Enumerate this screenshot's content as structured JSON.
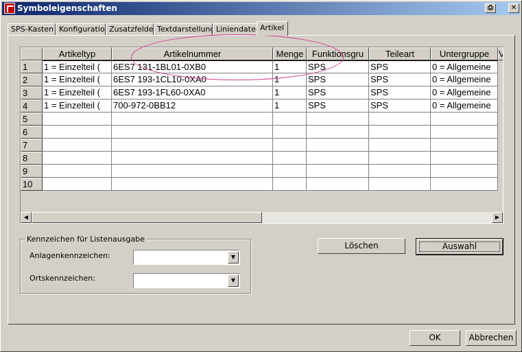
{
  "window": {
    "title": "Symboleigenschaften"
  },
  "tabs": [
    {
      "label": "SPS-Kasten"
    },
    {
      "label": "Konfiguration"
    },
    {
      "label": "Zusatzfelder"
    },
    {
      "label": "Textdarstellung"
    },
    {
      "label": "Liniendaten"
    },
    {
      "label": "Artikel",
      "active": true
    }
  ],
  "grid": {
    "columns": [
      "",
      "Artikeltyp",
      "Artikelnummer",
      "Menge",
      "Funktionsgru",
      "Teileart",
      "Untergruppe",
      "V"
    ],
    "rows": [
      [
        "1",
        "1 = Einzelteil (",
        "6ES7 131-1BL01-0XB0",
        "1",
        "SPS",
        "SPS",
        "0 = Allgemeine"
      ],
      [
        "2",
        "1 = Einzelteil (",
        "6ES7 193-1CL10-0XA0",
        "1",
        "SPS",
        "SPS",
        "0 = Allgemeine"
      ],
      [
        "3",
        "1 = Einzelteil (",
        "6ES7 193-1FL60-0XA0",
        "1",
        "SPS",
        "SPS",
        "0 = Allgemeine"
      ],
      [
        "4",
        "1 = Einzelteil (",
        "700-972-0BB12",
        "1",
        "SPS",
        "SPS",
        "0 = Allgemeine"
      ],
      [
        "5",
        "",
        "",
        "",
        "",
        "",
        ""
      ],
      [
        "6",
        "",
        "",
        "",
        "",
        "",
        ""
      ],
      [
        "7",
        "",
        "",
        "",
        "",
        "",
        ""
      ],
      [
        "8",
        "",
        "",
        "",
        "",
        "",
        ""
      ],
      [
        "9",
        "",
        "",
        "",
        "",
        "",
        ""
      ],
      [
        "10",
        "",
        "",
        "",
        "",
        "",
        ""
      ]
    ]
  },
  "kennzeichen": {
    "legend": "Kennzeichen für Listenausgabe",
    "anlagen_label": "Anlagenkennzeichen:",
    "anlagen_value": "",
    "orts_label": "Ortskennzeichen:",
    "orts_value": ""
  },
  "buttons": {
    "loeschen": "Löschen",
    "auswahl": "Auswahl",
    "ok": "OK",
    "abbrechen": "Abbrechen"
  },
  "colors": {
    "titlebar_start": "#0a246a",
    "annotation": "#d23c8c"
  }
}
